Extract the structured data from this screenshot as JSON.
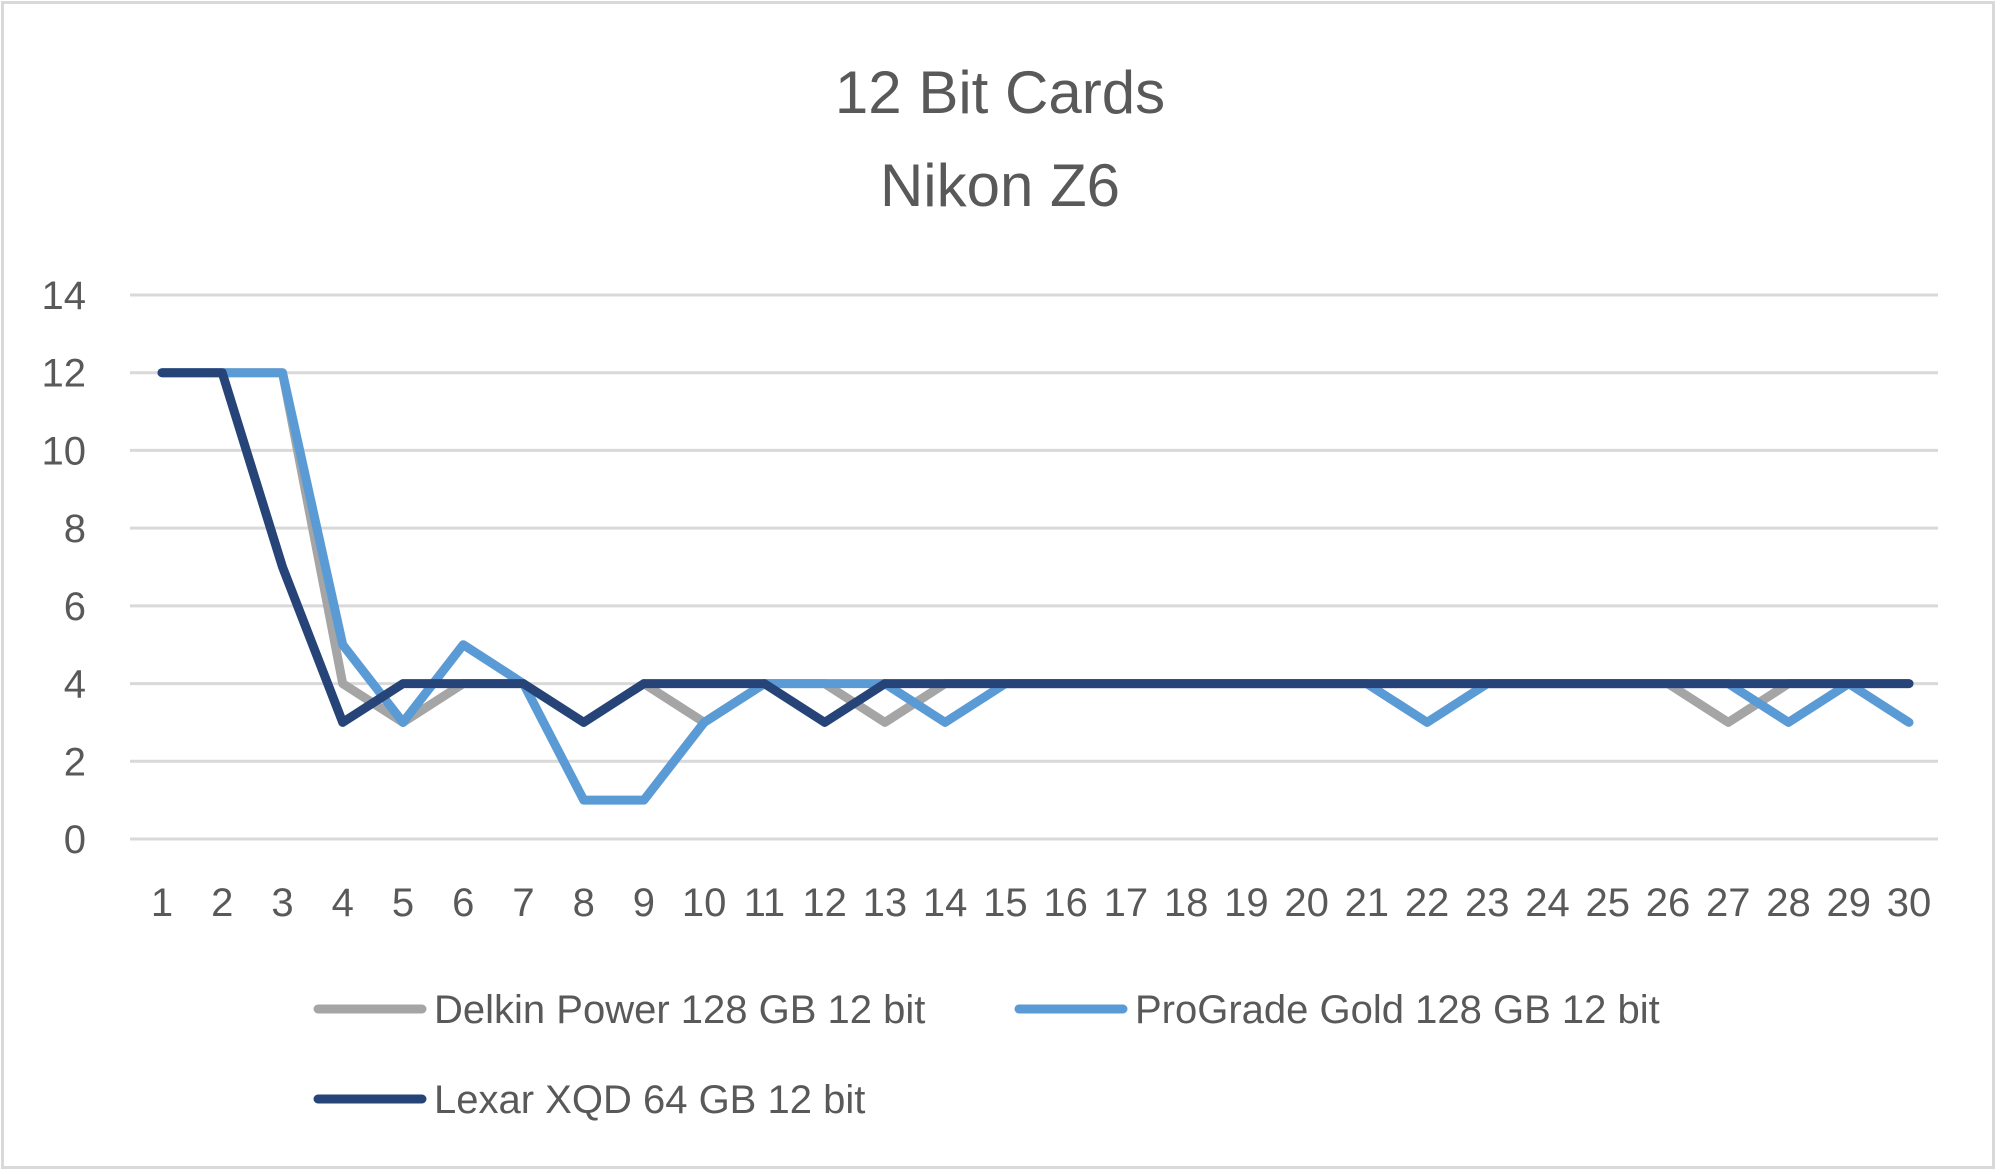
{
  "chart_data": {
    "type": "line",
    "title": "12 Bit Cards",
    "subtitle": "Nikon Z6",
    "xlabel": "",
    "ylabel": "",
    "x": [
      1,
      2,
      3,
      4,
      5,
      6,
      7,
      8,
      9,
      10,
      11,
      12,
      13,
      14,
      15,
      16,
      17,
      18,
      19,
      20,
      21,
      22,
      23,
      24,
      25,
      26,
      27,
      28,
      29,
      30
    ],
    "ylim": [
      0,
      14
    ],
    "yticks": [
      0,
      2,
      4,
      6,
      8,
      10,
      12,
      14
    ],
    "grid": true,
    "legend_position": "bottom",
    "series": [
      {
        "name": "Delkin Power 128 GB 12 bit",
        "color": "#a5a5a5",
        "values": [
          12,
          12,
          12,
          4,
          3,
          4,
          4,
          3,
          4,
          3,
          4,
          4,
          3,
          4,
          4,
          4,
          4,
          4,
          4,
          4,
          4,
          4,
          4,
          4,
          4,
          4,
          3,
          4,
          4,
          4
        ]
      },
      {
        "name": "ProGrade Gold 128 GB 12 bit",
        "color": "#5b9bd5",
        "values": [
          12,
          12,
          12,
          5,
          3,
          5,
          4,
          1,
          1,
          3,
          4,
          4,
          4,
          3,
          4,
          4,
          4,
          4,
          4,
          4,
          4,
          3,
          4,
          4,
          4,
          4,
          4,
          3,
          4,
          3
        ]
      },
      {
        "name": "Lexar XQD 64 GB 12 bit",
        "color": "#264478",
        "values": [
          12,
          12,
          7,
          3,
          4,
          4,
          4,
          3,
          4,
          4,
          4,
          3,
          4,
          4,
          4,
          4,
          4,
          4,
          4,
          4,
          4,
          4,
          4,
          4,
          4,
          4,
          4,
          4,
          4,
          4
        ]
      }
    ]
  }
}
